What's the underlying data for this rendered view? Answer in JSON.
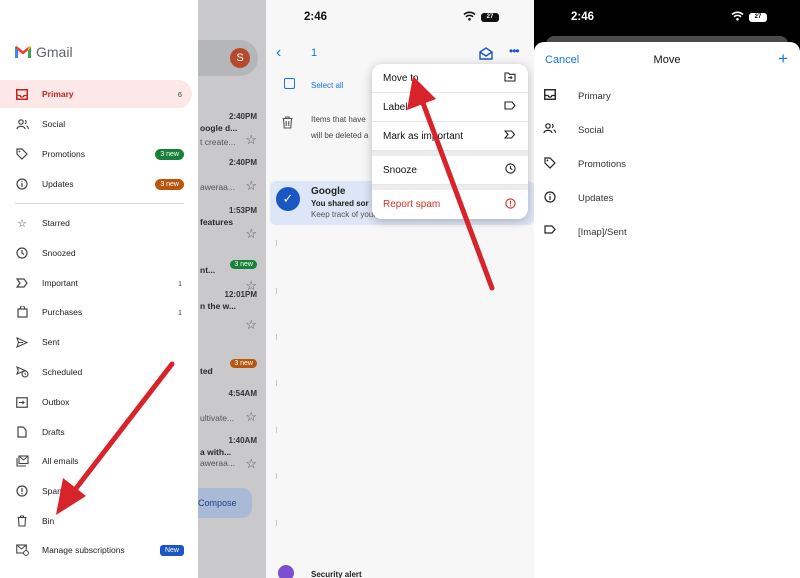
{
  "colors": {
    "gmail_red": "#c5221f",
    "accent_blue": "#1a73e8",
    "arrow_red": "#d8232a",
    "badge_green": "#188038",
    "badge_orange": "#b8560d",
    "badge_blue": "#1a56c4"
  },
  "panel1": {
    "app_name": "Gmail",
    "background": {
      "avatar_letter": "S",
      "rows": [
        {
          "time": "2:40PM",
          "line1": "oogle d...",
          "line2": "t create..."
        },
        {
          "time": "2:40PM",
          "line1": "",
          "line2": "aweraa..."
        },
        {
          "time": "1:53PM",
          "line1": "features",
          "line2": ""
        },
        {
          "time": "",
          "line1": "nt...",
          "line2": ""
        },
        {
          "time": "12:01PM",
          "line1": "n the w...",
          "line2": ""
        },
        {
          "time": "",
          "line1": "ted",
          "line2": ""
        },
        {
          "time": "4:54AM",
          "line1": "",
          "line2": "ultivate..."
        },
        {
          "time": "1:40AM",
          "line1": "a with...",
          "line2": "aweraa..."
        }
      ],
      "badges": [
        "3 new",
        "3 new"
      ],
      "compose_label": "Compose"
    },
    "nav": [
      {
        "label": "Primary",
        "icon": "inbox-icon",
        "count": "6",
        "active": true
      },
      {
        "label": "Social",
        "icon": "people-icon",
        "count": ""
      },
      {
        "label": "Promotions",
        "icon": "tag-icon",
        "badge": "3 new",
        "badge_color": "#188038"
      },
      {
        "label": "Updates",
        "icon": "info-icon",
        "badge": "3 new",
        "badge_color": "#b8560d"
      },
      {
        "label": "Starred",
        "icon": "star-icon",
        "count": ""
      },
      {
        "label": "Snoozed",
        "icon": "clock-icon",
        "count": ""
      },
      {
        "label": "Important",
        "icon": "important-icon",
        "count": "1"
      },
      {
        "label": "Purchases",
        "icon": "purchases-icon",
        "count": "1"
      },
      {
        "label": "Sent",
        "icon": "send-icon",
        "count": ""
      },
      {
        "label": "Scheduled",
        "icon": "scheduled-icon",
        "count": ""
      },
      {
        "label": "Outbox",
        "icon": "outbox-icon",
        "count": ""
      },
      {
        "label": "Drafts",
        "icon": "draft-icon",
        "count": ""
      },
      {
        "label": "All emails",
        "icon": "all-mail-icon",
        "count": ""
      },
      {
        "label": "Spam",
        "icon": "spam-icon",
        "count": ""
      },
      {
        "label": "Bin",
        "icon": "bin-icon",
        "count": ""
      },
      {
        "label": "Manage subscriptions",
        "icon": "subscriptions-icon",
        "badge": "New",
        "badge_color": "#1a56c4"
      }
    ]
  },
  "panel2": {
    "status_time": "2:46",
    "battery": "27",
    "selected_count": "1",
    "select_all": "Select all",
    "notice_line1": "Items that have",
    "notice_line2": "will be deleted a",
    "email": {
      "from": "Google",
      "subject": "You shared sor",
      "preview": "Keep track of your Google Account data sawer..."
    },
    "partial_row": "Security alert",
    "menu": [
      {
        "label": "Move to",
        "icon": "move-to-icon"
      },
      {
        "label": "Label",
        "icon": "label-icon"
      },
      {
        "label": "Mark as important",
        "icon": "important-icon"
      },
      {
        "label": "Snooze",
        "icon": "clock-icon"
      },
      {
        "label": "Report spam",
        "icon": "spam-icon"
      }
    ]
  },
  "panel3": {
    "status_time": "2:46",
    "battery": "27",
    "cancel": "Cancel",
    "title": "Move",
    "add": "+",
    "folders": [
      {
        "label": "Primary",
        "icon": "inbox-icon"
      },
      {
        "label": "Social",
        "icon": "people-icon"
      },
      {
        "label": "Promotions",
        "icon": "tag-icon"
      },
      {
        "label": "Updates",
        "icon": "info-icon"
      },
      {
        "label": "[Imap]/Sent",
        "icon": "label-icon"
      }
    ]
  }
}
